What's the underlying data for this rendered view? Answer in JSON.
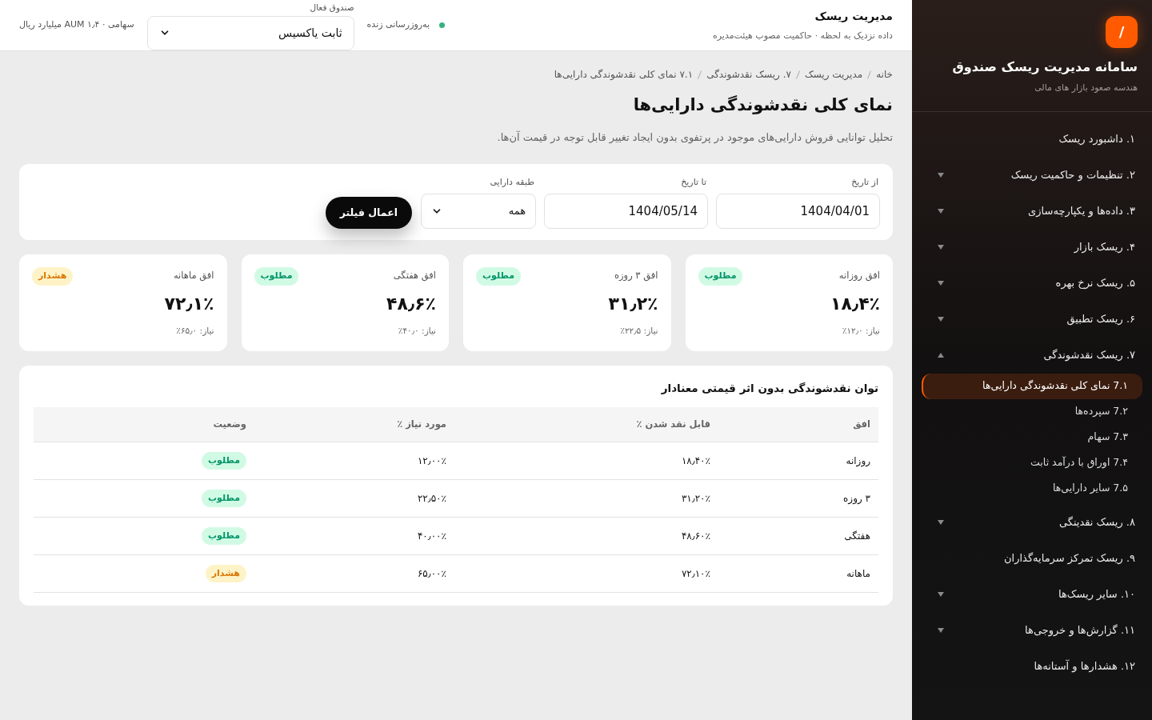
{
  "sidebar": {
    "logo": "/",
    "title": "سامانه مدیریت ریسک صندوق",
    "subtitle": "هندسه صعود بازار های مالی",
    "items": [
      {
        "label": "۱. داشبورد ریسک"
      },
      {
        "label": "۲. تنظیمات و حاکمیت ریسک",
        "expanded": false
      },
      {
        "label": "۳. داده‌ها و یکپارچه‌سازی",
        "expanded": false
      },
      {
        "label": "۴. ریسک بازار",
        "expanded": false
      },
      {
        "label": "۵. ریسک نرخ بهره",
        "expanded": false
      },
      {
        "label": "۶. ریسک تطبیق",
        "expanded": false
      },
      {
        "label": "۷. ریسک نقدشوندگی",
        "expanded": true,
        "children": [
          {
            "label": "7.۱ نمای کلی نقدشوندگی دارایی‌ها",
            "selected": true
          },
          {
            "label": "7.۲ سپرده‌ها",
            "selected": false
          },
          {
            "label": "7.۳ سهام",
            "selected": false
          },
          {
            "label": "7.۴ اوراق با درآمد ثابت",
            "selected": false
          },
          {
            "label": "7.۵ سایر دارایی‌ها",
            "selected": false
          }
        ]
      },
      {
        "label": "۸. ریسک نقدینگی",
        "expanded": false
      },
      {
        "label": "۹. ریسک تمرکز سرمایه‌گذاران"
      },
      {
        "label": "۱۰. سایر ریسک‌ها",
        "expanded": false
      },
      {
        "label": "۱۱. گزارش‌ها و خروجی‌ها",
        "expanded": false
      },
      {
        "label": "۱۲. هشدارها و آستانه‌ها"
      }
    ]
  },
  "header": {
    "title": "مدیریت ریسک",
    "subtitle": "داده نزدیک به لحظه · حاکمیت مصوب هیئت‌مدیره",
    "live": {
      "on": true,
      "label": "به‌روزرسانی زنده"
    },
    "fund_select": {
      "label": "صندوق فعال",
      "value": "ثابت یاکسیس"
    },
    "fund_info": "سهامی · AUM ۱٫۴ میلیارد ریال"
  },
  "breadcrumb": [
    "خانه",
    "مدیریت ریسک",
    "۷. ریسک نقدشوندگی",
    "۷.۱ نمای کلی نقدشوندگی دارایی‌ها"
  ],
  "page": {
    "title": "نمای کلی نقدشوندگی دارایی‌ها",
    "description": "تحلیل توانایی فروش دارایی‌های موجود در پرتفوی بدون ایجاد تغییر قابل توجه در قیمت آن‌ها."
  },
  "filters": {
    "from": {
      "label": "از تاریخ",
      "value": "1404/04/01"
    },
    "to": {
      "label": "تا تاریخ",
      "value": "1404/05/14"
    },
    "asset_class": {
      "label": "طبقه دارایی",
      "value": "همه"
    },
    "apply": "اعمال فیلتر"
  },
  "cards": [
    {
      "label": "افق روزانه",
      "value": "۱۸٫۴٪",
      "need": "نیاز: ۱۲٫۰٪",
      "kind": "ok",
      "badge": "مطلوب"
    },
    {
      "label": "افق ۳ روزه",
      "value": "۳۱٫۲٪",
      "need": "نیاز: ۲۲٫۵٪",
      "kind": "ok",
      "badge": "مطلوب"
    },
    {
      "label": "افق هفتگی",
      "value": "۴۸٫۶٪",
      "need": "نیاز: ۴۰٫۰٪",
      "kind": "ok",
      "badge": "مطلوب"
    },
    {
      "label": "افق ماهانه",
      "value": "۷۲٫۱٪",
      "need": "نیاز: ۶۵٫۰٪",
      "kind": "warning",
      "badge": "هشدار"
    }
  ],
  "table": {
    "title": "توان نقدشوندگی بدون اثر قیمتی معنادار",
    "columns": [
      "افق",
      "قابل نقد شدن ٪",
      "مورد نیاز ٪",
      "وضعیت"
    ],
    "rows": [
      {
        "horizon": "روزانه",
        "liquid": "۱۸٫۴۰٪",
        "required": "۱۲٫۰۰٪",
        "kind": "ok",
        "badge": "مطلوب"
      },
      {
        "horizon": "۳ روزه",
        "liquid": "۳۱٫۲۰٪",
        "required": "۲۲٫۵۰٪",
        "kind": "ok",
        "badge": "مطلوب"
      },
      {
        "horizon": "هفتگی",
        "liquid": "۴۸٫۶۰٪",
        "required": "۴۰٫۰۰٪",
        "kind": "ok",
        "badge": "مطلوب"
      },
      {
        "horizon": "ماهانه",
        "liquid": "۷۲٫۱۰٪",
        "required": "۶۵٫۰۰٪",
        "kind": "warning",
        "badge": "هشدار"
      }
    ]
  }
}
